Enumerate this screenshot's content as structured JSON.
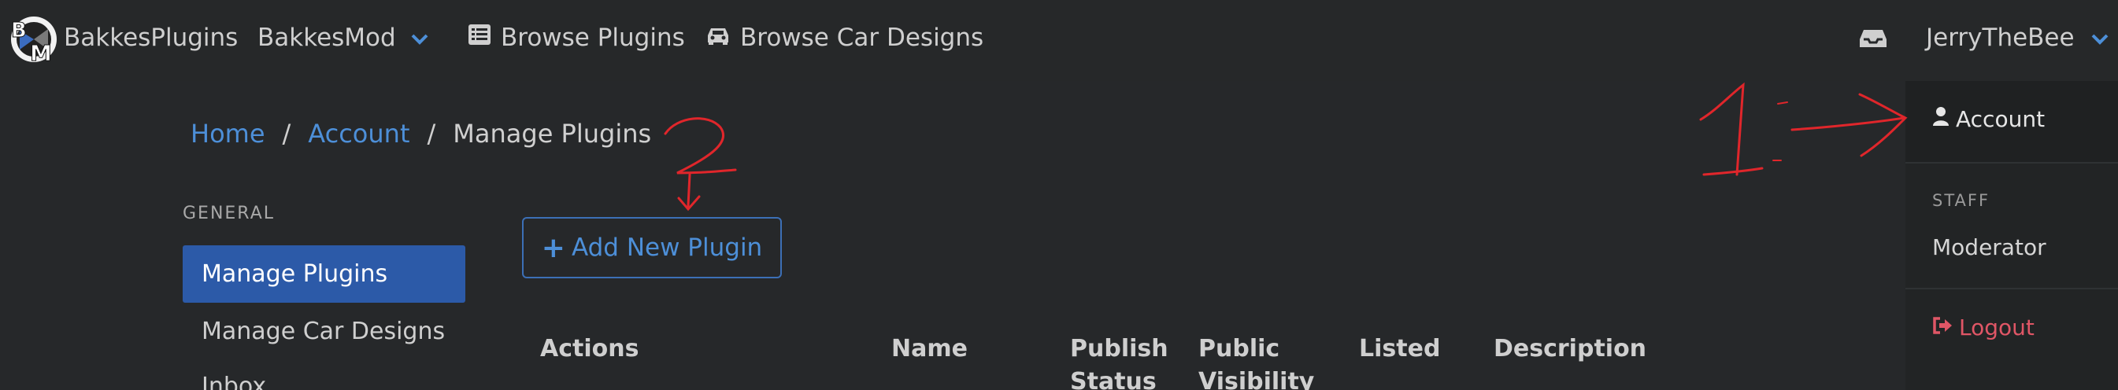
{
  "navbar": {
    "logo_text": "BM",
    "brand": "BakkesPlugins",
    "items": [
      {
        "label": "BakkesMod",
        "icon": "chevron-down-icon"
      },
      {
        "label": "Browse Plugins",
        "icon": "list-icon"
      },
      {
        "label": "Browse Car Designs",
        "icon": "car-icon"
      }
    ],
    "inbox_icon": "inbox-icon",
    "user": "JerryTheBee"
  },
  "dropdown": {
    "account": "Account",
    "staff_header": "STAFF",
    "moderator": "Moderator",
    "logout": "Logout"
  },
  "breadcrumb": {
    "home": "Home",
    "separator": "/",
    "account": "Account",
    "current": "Manage Plugins"
  },
  "sidebar": {
    "header": "GENERAL",
    "items": [
      "Manage Plugins",
      "Manage Car Designs",
      "Inbox"
    ]
  },
  "main": {
    "add_button": "Add New Plugin",
    "table_headers": [
      "Actions",
      "Name",
      "Publish Status",
      "Public Visibility",
      "Listed",
      "Description"
    ]
  },
  "annotations": [
    "1",
    "2"
  ],
  "colors": {
    "background": "#26282a",
    "link": "#4d8fd8",
    "active": "#2c5aa8",
    "logout": "#e05666",
    "annotation": "#e0262b"
  }
}
